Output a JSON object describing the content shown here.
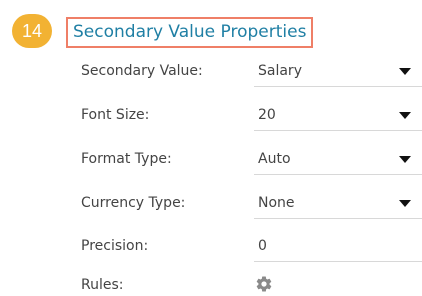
{
  "step_badge": "14",
  "section_title": "Secondary Value Properties",
  "properties": [
    {
      "label": "Secondary Value:",
      "value": "Salary",
      "control": "dropdown"
    },
    {
      "label": "Font Size:",
      "value": "20",
      "control": "dropdown"
    },
    {
      "label": "Format Type:",
      "value": "Auto",
      "control": "dropdown"
    },
    {
      "label": "Currency Type:",
      "value": "None",
      "control": "dropdown"
    },
    {
      "label": "Precision:",
      "value": "0",
      "control": "number"
    },
    {
      "label": "Rules:",
      "value": null,
      "control": "gear-icon"
    }
  ],
  "colors": {
    "badge": "#f2b233",
    "title_text": "#1f7fa4",
    "title_border": "#ef7f67",
    "label_text": "#444444"
  }
}
